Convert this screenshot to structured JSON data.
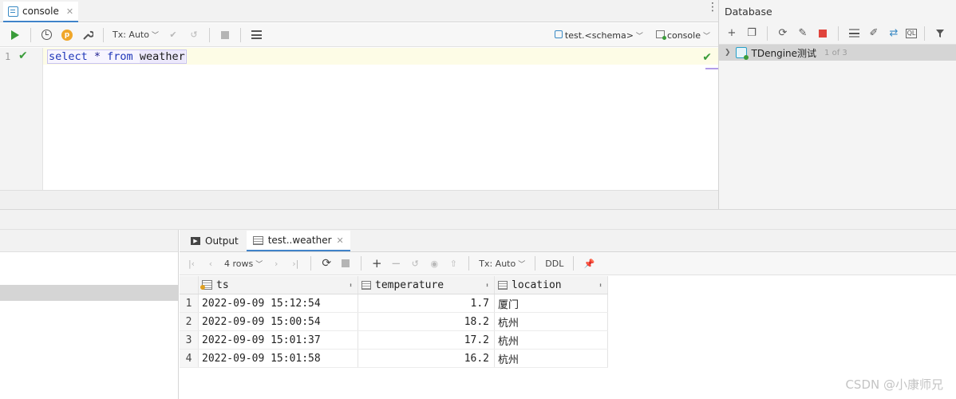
{
  "editor": {
    "tab_label": "console",
    "tab_close": "✕",
    "menu_glyph": "⋮",
    "toolbar": {
      "tx_label": "Tx: Auto",
      "schema_label": "test.<schema>",
      "session_label": "console"
    },
    "line_number": "1",
    "code": {
      "kw1": "select",
      "star": " * ",
      "kw2": "from",
      "space": " ",
      "table": "weather"
    }
  },
  "database": {
    "title": "Database",
    "tree": {
      "source_name": "TDengine测试",
      "count": "1 of 3"
    }
  },
  "results": {
    "tabs": [
      {
        "label": "Output"
      },
      {
        "label": "test..weather"
      }
    ],
    "toolbar": {
      "rows_label": "4 rows",
      "tx_label": "Tx: Auto",
      "ddl_label": "DDL"
    },
    "columns": [
      {
        "name": "ts"
      },
      {
        "name": "temperature"
      },
      {
        "name": "location"
      }
    ],
    "rows": [
      {
        "n": "1",
        "ts": "2022-09-09 15:12:54",
        "temperature": "1.7",
        "location": "厦门"
      },
      {
        "n": "2",
        "ts": "2022-09-09 15:00:54",
        "temperature": "18.2",
        "location": "杭州"
      },
      {
        "n": "3",
        "ts": "2022-09-09 15:01:37",
        "temperature": "17.2",
        "location": "杭州"
      },
      {
        "n": "4",
        "ts": "2022-09-09 15:01:58",
        "temperature": "16.2",
        "location": "杭州"
      }
    ]
  },
  "watermark": "CSDN @小康师兄",
  "colors": {
    "accent": "#4083c9",
    "run_green": "#3a9c3a",
    "stop_red": "#e0443c"
  }
}
